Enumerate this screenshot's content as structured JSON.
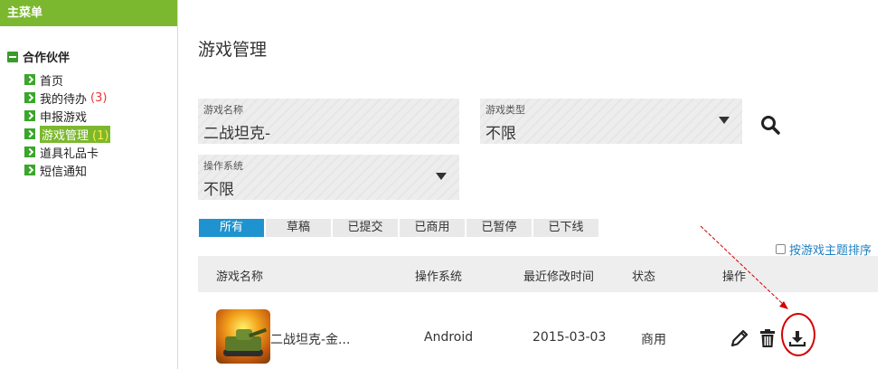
{
  "sidebar": {
    "header": "主菜单",
    "root": "合作伙伴",
    "items": [
      {
        "label": "首页",
        "count": ""
      },
      {
        "label": "我的待办",
        "count": "(3)"
      },
      {
        "label": "申报游戏",
        "count": ""
      },
      {
        "label": "游戏管理",
        "count": "(1)"
      },
      {
        "label": "道具礼品卡",
        "count": ""
      },
      {
        "label": "短信通知",
        "count": ""
      }
    ]
  },
  "main": {
    "title": "游戏管理",
    "filters": {
      "game_name": {
        "label": "游戏名称",
        "value": "二战坦克-"
      },
      "game_type": {
        "label": "游戏类型",
        "value": "不限"
      },
      "os": {
        "label": "操作系统",
        "value": "不限"
      }
    },
    "tabs": [
      "所有",
      "草稿",
      "已提交",
      "已商用",
      "已暂停",
      "已下线"
    ],
    "sort_option": "按游戏主题排序",
    "columns": [
      "游戏名称",
      "操作系统",
      "最近修改时间",
      "状态",
      "操作"
    ],
    "rows": [
      {
        "name": "二战坦克-金...",
        "os": "Android",
        "modified": "2015-03-03",
        "status": "商用"
      }
    ]
  },
  "colors": {
    "brand_green": "#7cb82f",
    "tab_active": "#1e93cf",
    "annotation_red": "#d40000"
  },
  "icons": [
    "minus-icon",
    "arrow-right-icon",
    "chevron-down-icon",
    "search-icon",
    "edit-icon",
    "trash-icon",
    "download-icon"
  ]
}
